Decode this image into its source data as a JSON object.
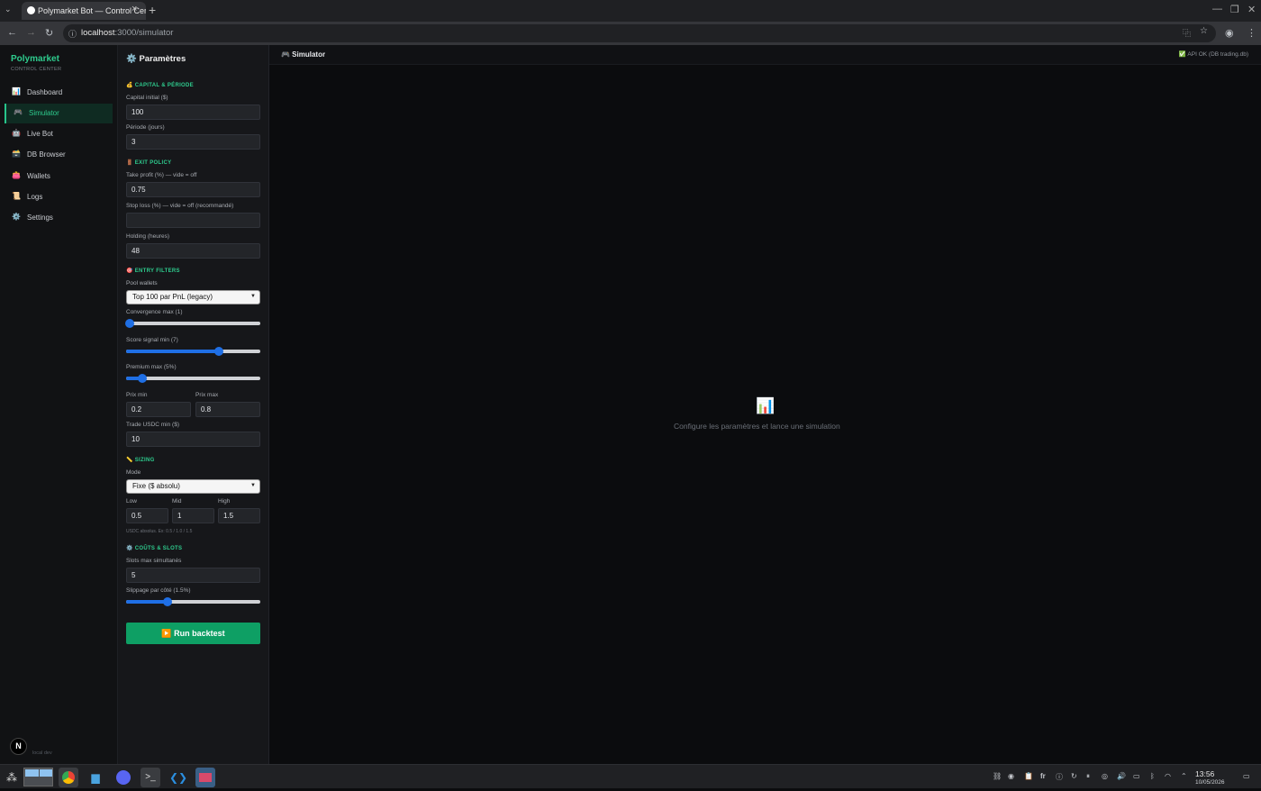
{
  "browser": {
    "tab_title": "Polymarket Bot — Control Cent",
    "url_host": "localhost",
    "url_path": ":3000/simulator"
  },
  "sidebar": {
    "brand": "Polymarket",
    "brand_sub": "CONTROL CENTER",
    "items": [
      {
        "label": "Dashboard",
        "icon": "📊"
      },
      {
        "label": "Simulator",
        "icon": "🎮"
      },
      {
        "label": "Live Bot",
        "icon": "🤖"
      },
      {
        "label": "DB Browser",
        "icon": "🗃️"
      },
      {
        "label": "Wallets",
        "icon": "👛"
      },
      {
        "label": "Logs",
        "icon": "📜"
      },
      {
        "label": "Settings",
        "icon": "⚙️"
      }
    ],
    "footer": "local dev",
    "badge": "N"
  },
  "params": {
    "title": "⚙️ Paramètres",
    "capital": {
      "section": "💰 CAPITAL & PÉRIODE",
      "capital_label": "Capital initial ($)",
      "capital_value": "100",
      "periode_label": "Période (jours)",
      "periode_value": "3"
    },
    "exit": {
      "section": "🚪 EXIT POLICY",
      "tp_label": "Take profit (%) — vide = off",
      "tp_value": "0.75",
      "sl_label": "Stop loss (%) — vide = off (recommandé)",
      "sl_value": "",
      "holding_label": "Holding (heures)",
      "holding_value": "48"
    },
    "entry": {
      "section": "🎯 ENTRY FILTERS",
      "pool_label": "Pool wallets",
      "pool_value": "Top 100 par PnL (legacy)",
      "convergence_label": "Convergence max (1)",
      "convergence_level": 0.03,
      "score_label": "Score signal min (7)",
      "score_level": 0.69,
      "premium_label": "Premium max (5%)",
      "premium_level": 0.12,
      "prix_min_label": "Prix min",
      "prix_min_value": "0.2",
      "prix_max_label": "Prix max",
      "prix_max_value": "0.8",
      "trade_label": "Trade USDC min ($)",
      "trade_value": "10"
    },
    "sizing": {
      "section": "📏 SIZING",
      "mode_label": "Mode",
      "mode_value": "Fixe ($ absolu)",
      "low_label": "Low",
      "low_value": "0.5",
      "mid_label": "Mid",
      "mid_value": "1",
      "high_label": "High",
      "high_value": "1.5",
      "hint": "USDC absolus. Ex: 0.5 / 1.0 / 1.5"
    },
    "costs": {
      "section": "⚙️ COÛTS & SLOTS",
      "slots_label": "Slots max simultanés",
      "slots_value": "5",
      "slippage_label": "Slippage par côté (1.5%)",
      "slippage_level": 0.31
    },
    "run_label": "▶️ Run backtest"
  },
  "main": {
    "title": "🎮 Simulator",
    "api_status": "✅ API OK (DB trading.db)",
    "empty_icon": "📊",
    "empty_message": "Configure les paramètres et lance une simulation"
  },
  "taskbar": {
    "lang": "fr",
    "time": "13:56",
    "date": "10/05/2026"
  }
}
